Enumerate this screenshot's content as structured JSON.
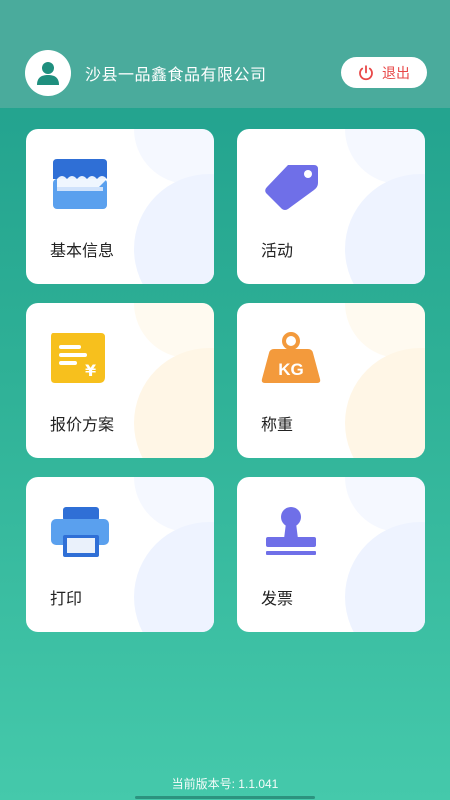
{
  "header": {
    "company_name": "沙县一品鑫食品有限公司",
    "logout_label": "退出",
    "avatar_icon": "user-icon",
    "logout_icon": "power-icon",
    "logout_color": "#e84848"
  },
  "menu": {
    "items": [
      {
        "label": "基本信息",
        "icon": "store-icon"
      },
      {
        "label": "活动",
        "icon": "tag-icon"
      },
      {
        "label": "报价方案",
        "icon": "quote-doc-icon"
      },
      {
        "label": "称重",
        "icon": "weight-kg-icon",
        "icon_text": "KG"
      },
      {
        "label": "打印",
        "icon": "printer-icon"
      },
      {
        "label": "发票",
        "icon": "stamp-icon"
      }
    ]
  },
  "footer": {
    "version_text": "当前版本号: 1.1.041"
  },
  "colors": {
    "background_top": "#1f9e8c",
    "background_bottom": "#45c9ab",
    "topbar": "#4aab9c",
    "icon_blue": "#4a90e2",
    "icon_purple": "#6f6fe8",
    "icon_yellow": "#f7c01d",
    "icon_orange": "#f39a3c"
  }
}
